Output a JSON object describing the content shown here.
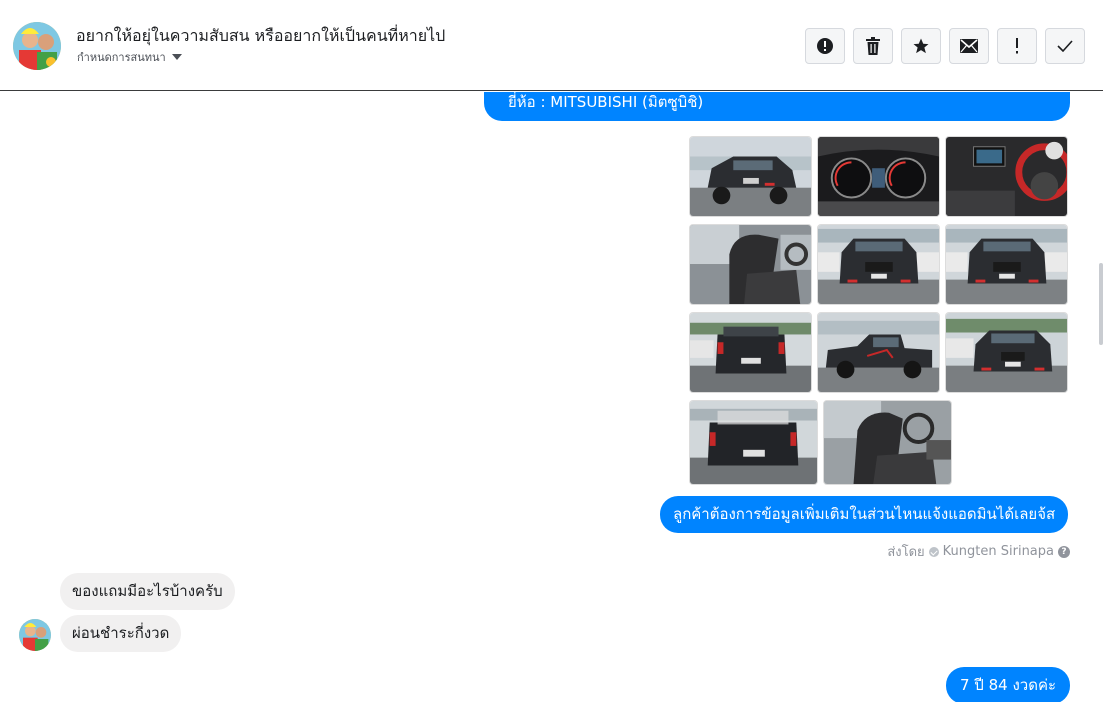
{
  "header": {
    "title": "อยากให้อยุ่ในความสับสน หรืออยากให้เป็นคนที่หายไป",
    "subtitle": "กำหนดการสนทนา"
  },
  "toolbar": {
    "buttons": [
      {
        "name": "spam-report-button",
        "icon": "alert-circle-icon"
      },
      {
        "name": "delete-button",
        "icon": "trash-icon"
      },
      {
        "name": "star-button",
        "icon": "star-icon"
      },
      {
        "name": "mark-unread-button",
        "icon": "envelope-icon"
      },
      {
        "name": "important-button",
        "icon": "exclamation-icon"
      },
      {
        "name": "mark-done-button",
        "icon": "checkmark-icon"
      }
    ]
  },
  "messages": {
    "brand": "ยี่ห้อ : MITSUBISHI (มิตซูบิชิ)",
    "ask_info": "ลูกค้าต้องการข้อมูลเพิ่มเติมในส่วนไหนแจ้งแอดมินได้เลยจ้ส",
    "sent_by_label": "ส่งโดย",
    "sent_by_name": "Kungten Sirinapa",
    "customer_q1": "ของแถมมีอะไรบ้างครับ",
    "customer_q2": "ผ่อนชำระกี่งวด",
    "reply_installments": "7  ปี  84 งวดค่ะ"
  },
  "photos": [
    {
      "name": "truck-front-photo",
      "subject": "truck"
    },
    {
      "name": "gauge-cluster-photo",
      "subject": "gauges"
    },
    {
      "name": "steering-wheel-photo",
      "subject": "steering"
    },
    {
      "name": "rear-seat-photo",
      "subject": "seat"
    },
    {
      "name": "truck-front-2-photo",
      "subject": "truck"
    },
    {
      "name": "truck-front-3-photo",
      "subject": "truck"
    },
    {
      "name": "truck-rear-photo",
      "subject": "truck-rear"
    },
    {
      "name": "truck-side-photo",
      "subject": "truck-side"
    },
    {
      "name": "truck-front-4-photo",
      "subject": "truck"
    },
    {
      "name": "truck-rear-2-photo",
      "subject": "truck-rear"
    },
    {
      "name": "front-seat-photo",
      "subject": "seat"
    }
  ],
  "colors": {
    "accent": "#0084ff",
    "incoming_bubble": "#f1f0f0",
    "truck_body": "#2b2d31"
  }
}
